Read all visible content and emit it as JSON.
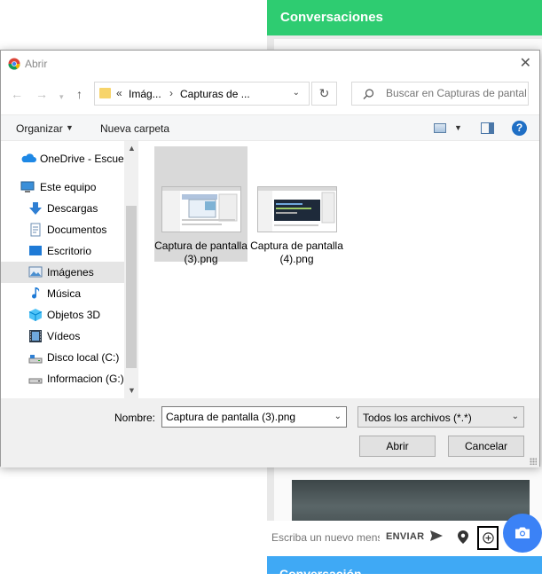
{
  "app": {
    "header_title": "Conversaciones",
    "composer": {
      "placeholder": "Escriba un nuevo mensaje",
      "send_label": "ENVIAR"
    },
    "footer_title": "Conversación"
  },
  "dialog": {
    "title": "Abrir",
    "address": {
      "root": "Imág...",
      "current": "Capturas de ..."
    },
    "search_placeholder": "Buscar en Capturas de pantalla",
    "toolbar": {
      "organize": "Organizar",
      "new_folder": "Nueva carpeta",
      "help": "?"
    },
    "nav_items": [
      {
        "label": "OneDrive - Escuel",
        "icon": "onedrive-icon"
      },
      {
        "label": "Este equipo",
        "icon": "computer-icon"
      },
      {
        "label": "Descargas",
        "icon": "download-icon"
      },
      {
        "label": "Documentos",
        "icon": "documents-icon"
      },
      {
        "label": "Escritorio",
        "icon": "desktop-icon"
      },
      {
        "label": "Imágenes",
        "icon": "pictures-icon",
        "selected": true
      },
      {
        "label": "Música",
        "icon": "music-icon"
      },
      {
        "label": "Objetos 3D",
        "icon": "3d-objects-icon"
      },
      {
        "label": "Vídeos",
        "icon": "videos-icon"
      },
      {
        "label": "Disco local (C:)",
        "icon": "drive-icon"
      },
      {
        "label": "Informacion (G:)",
        "icon": "drive-icon"
      }
    ],
    "files": [
      {
        "name": "Captura de pantalla (3).png",
        "selected": true
      },
      {
        "name": "Captura de pantalla (4).png",
        "selected": false
      }
    ],
    "filename_label": "Nombre:",
    "filename_value": "Captura de pantalla (3).png",
    "filetype_value": "Todos los archivos (*.*)",
    "open_button": "Abrir",
    "cancel_button": "Cancelar"
  },
  "colors": {
    "app_green": "#2ecc71",
    "app_blue": "#3b82f6",
    "selection_gray": "#d9d9d9"
  }
}
